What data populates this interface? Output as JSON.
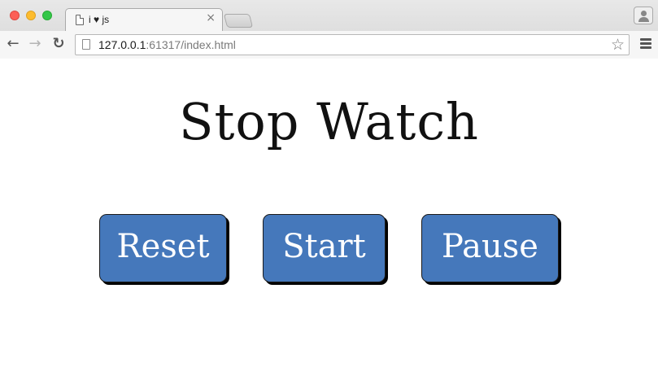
{
  "browser": {
    "tab": {
      "title": "i ♥ js",
      "close_glyph": "×"
    },
    "address_bar": {
      "host": "127.0.0.1",
      "rest": ":61317/index.html"
    },
    "icons": {
      "back": "back-arrow-icon",
      "forward": "forward-arrow-icon",
      "reload": "reload-icon",
      "page": "page-icon",
      "bookmark": "star-icon",
      "menu": "hamburger-menu-icon",
      "profile": "profile-icon"
    },
    "glyphs": {
      "back": "←",
      "forward": "→",
      "reload": "↻",
      "star": "☆"
    },
    "traffic_lights": {
      "close": "#fc5f57",
      "minimize": "#fdbc2e",
      "maximize": "#33c748"
    }
  },
  "page": {
    "title": "Stop Watch",
    "buttons": {
      "reset": "Reset",
      "start": "Start",
      "pause": "Pause"
    },
    "colors": {
      "button_fill": "#4578bb",
      "button_text": "#ffffff",
      "button_shadow": "#000000"
    }
  }
}
